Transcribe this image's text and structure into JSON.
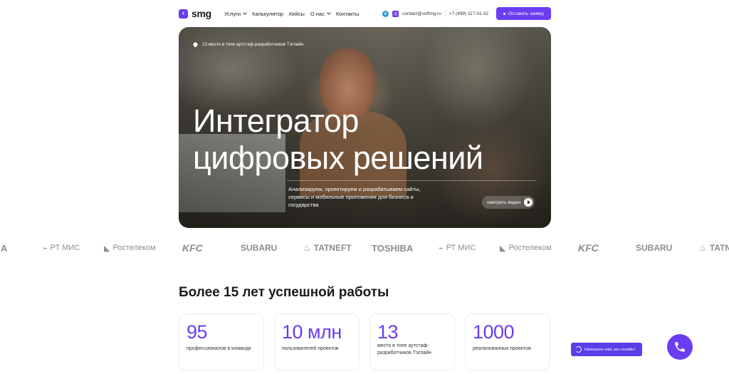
{
  "header": {
    "logo_text": "smg",
    "nav": [
      "Услуги",
      "Калькулятор",
      "Кейсы",
      "О нас",
      "Контакты"
    ],
    "email": "contact@softmg.ru",
    "phone": "+7 (499) 117-01-32",
    "cta_label": "Оставить заявку"
  },
  "hero": {
    "badge": "13 место в топе аутстаф-разработчиков Тэглайн",
    "title_line1": "Интегратор",
    "title_line2": "цифровых решений",
    "description": "Анализируем, проектируем и разрабатываем сайты, сервисы и мобильные приложения для бизнеса и государства",
    "video_button": "смотреть видео"
  },
  "clients": [
    {
      "name": "TOSHIBA",
      "icon": ""
    },
    {
      "name": "РТ МИС",
      "icon": "rtmis-icon"
    },
    {
      "name": "Ростелеком",
      "icon": "rostelecom-icon"
    },
    {
      "name": "KFC",
      "icon": ""
    },
    {
      "name": "SUBARU",
      "icon": ""
    },
    {
      "name": "TATNEFT",
      "icon": "tatneft-icon"
    },
    {
      "name": "TOSHIBA",
      "icon": ""
    },
    {
      "name": "РТ МИС",
      "icon": "rtmis-icon"
    },
    {
      "name": "Ростелеком",
      "icon": "rostelecom-icon"
    },
    {
      "name": "KFC",
      "icon": ""
    },
    {
      "name": "SUBARU",
      "icon": ""
    },
    {
      "name": "TATNEFT",
      "icon": "tatneft-icon"
    }
  ],
  "stats_section": {
    "title": "Более 15 лет успешной работы",
    "items": [
      {
        "value": "95",
        "label": "профессионалов в команде"
      },
      {
        "value": "10 млн",
        "label": "пользователей проектов"
      },
      {
        "value": "13",
        "label": "место в топе аутстаф-разработчиков Тэглайн"
      },
      {
        "value": "1000",
        "label": "реализованных проектов"
      }
    ]
  },
  "chat": {
    "label": "Напишите нам, мы онлайн!"
  },
  "colors": {
    "accent": "#6a3df2",
    "logo_gray": "#8c8c94"
  }
}
